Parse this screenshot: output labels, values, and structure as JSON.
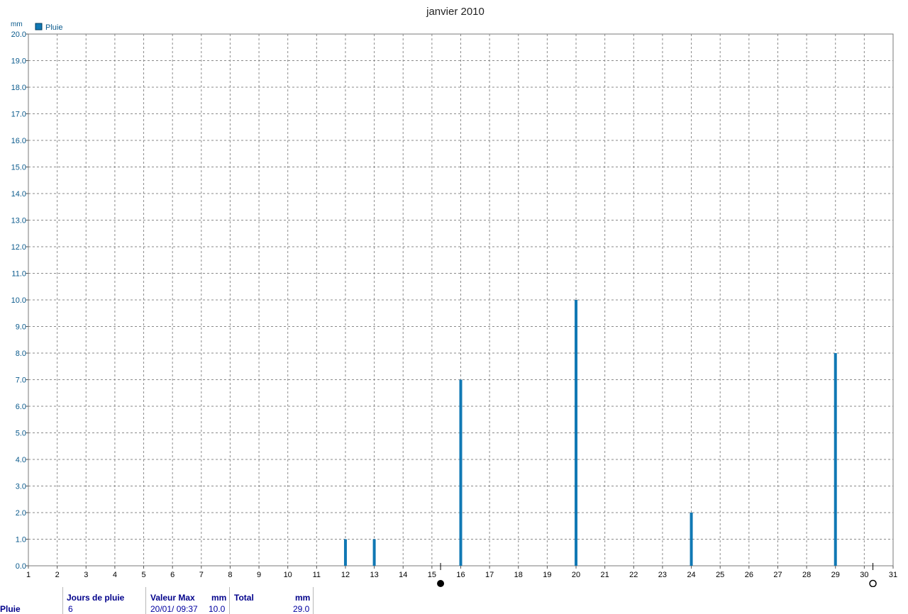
{
  "chart_data": {
    "type": "bar",
    "title": "janvier 2010",
    "ylabel": "mm",
    "legend": {
      "label": "Pluie",
      "color": "#1078b4",
      "position": "top-left"
    },
    "x_ticks": [
      "1",
      "2",
      "3",
      "4",
      "5",
      "6",
      "7",
      "8",
      "9",
      "10",
      "11",
      "12",
      "13",
      "14",
      "15",
      "16",
      "17",
      "18",
      "19",
      "20",
      "21",
      "22",
      "23",
      "24",
      "25",
      "26",
      "27",
      "28",
      "29",
      "30",
      "31"
    ],
    "xlim": [
      1,
      31
    ],
    "ylim": [
      0,
      20
    ],
    "y_ticks": [
      "0.0",
      "1.0",
      "2.0",
      "3.0",
      "4.0",
      "5.0",
      "6.0",
      "7.0",
      "8.0",
      "9.0",
      "10.0",
      "11.0",
      "12.0",
      "13.0",
      "14.0",
      "15.0",
      "16.0",
      "17.0",
      "18.0",
      "19.0",
      "20.0"
    ],
    "grid": true,
    "series": [
      {
        "name": "Pluie",
        "color": "#1078b4",
        "x": [
          12,
          13,
          16,
          20,
          24,
          29
        ],
        "values": [
          1.0,
          1.0,
          7.0,
          10.0,
          2.0,
          8.0
        ]
      }
    ],
    "moon_phases": [
      {
        "phase": "full-moon-icon",
        "x": 15.3
      },
      {
        "phase": "new-moon-icon",
        "x": 30.3
      }
    ]
  },
  "stats": {
    "row_label": "Pluie",
    "headers": {
      "days": "Jours de pluie",
      "max": "Valeur Max",
      "max_unit": "mm",
      "total": "Total",
      "total_unit": "mm"
    },
    "values": {
      "days": "6",
      "max_date": "20/01/  09:37",
      "max_value": "10.0",
      "total": "29.0"
    }
  }
}
